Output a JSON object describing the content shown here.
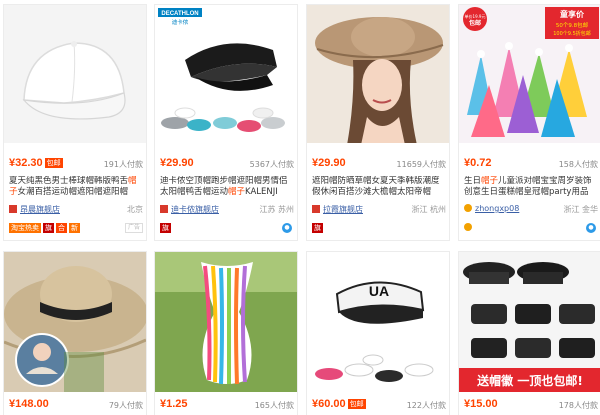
{
  "products": [
    {
      "price": "¥32.30",
      "badge": "包邮",
      "sold": "191人付款",
      "title_a": "夏天纯黑色男士棒球帽韩版鸭舌",
      "title_hl": "帽子",
      "title_b": "女潮百搭运动帽遮阳帽遮阳帽",
      "shop": "昂晨旗舰店",
      "location": "北京",
      "tags": [
        "淘宝热卖",
        "旗",
        "合",
        "新"
      ],
      "ad": "广告"
    },
    {
      "price": "¥29.90",
      "badge": "",
      "sold": "5367人付款",
      "brand_logo": "DECATHLON",
      "brand_sub": "迪卡侬",
      "title_a": "迪卡侬空顶帽跑步帽遮阳帽男情侣太阳帽鸭舌帽运动",
      "title_hl": "帽子",
      "title_b": "KALENJI",
      "shop": "迪卡侬旗舰店",
      "location": "江苏 苏州",
      "tags": [
        "旗"
      ]
    },
    {
      "price": "¥29.90",
      "badge": "",
      "sold": "11659人付款",
      "title_a": "遮阳帽防晒草帽女夏天季韩版潮度假休闲百搭沙滩大檐帽太阳帝帽",
      "title_hl": "",
      "title_b": "",
      "shop": "拉霞旗舰店",
      "location": "浙江 杭州",
      "tags": [
        "旗"
      ]
    },
    {
      "price": "¥0.72",
      "badge": "",
      "sold": "158人付款",
      "banner_title": "童享价",
      "banner_line1": "50个9.8包邮",
      "banner_line2": "100个9.5折包邮",
      "banner_stamp": "单价19.9元",
      "banner_stamp2": "包邮",
      "title_a": "生日",
      "title_hl": "帽子",
      "title_b": "儿童派对帽宝宝周岁装饰创意生日蛋糕帽皇冠帽party用品",
      "shop": "zhongxp08",
      "location": "浙江 金华",
      "tags": []
    },
    {
      "price": "¥148.00",
      "badge": "",
      "sold": "79人付款"
    },
    {
      "price": "¥1.25",
      "badge": "",
      "sold": "165人付款"
    },
    {
      "price": "¥60.00",
      "badge": "包邮",
      "sold": "122人付款"
    },
    {
      "price": "¥15.00",
      "badge": "",
      "sold": "178人付款",
      "banner_text": "送帽徽 一顶也包邮!"
    }
  ]
}
